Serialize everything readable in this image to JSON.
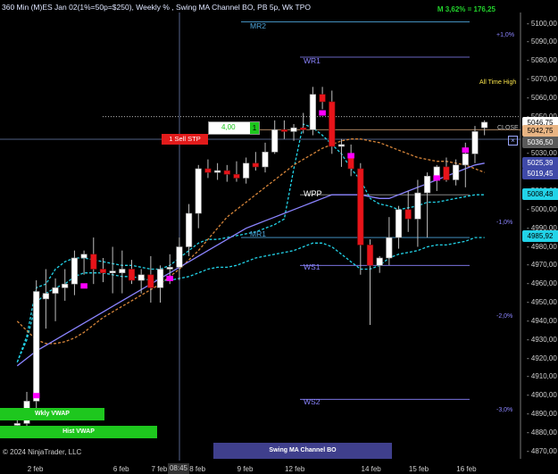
{
  "title": "360 Min (M)ES Jan 02(1%=50p=$250), Weekly % , Swing MA Channel BO, PB 5p, Wk TPO",
  "top_stat": "M 3,62% = 176,25",
  "copyright": "© 2024 NinjaTrader, LLC",
  "time_readout": "08:45",
  "levels": {
    "mr2": "MR2",
    "wr1": "WR1",
    "wpp": "WPP",
    "mr1": "MR1",
    "ws1": "WS1",
    "ws2": "WS2",
    "all_time_high": "All Time High",
    "close": "CLOSE"
  },
  "percent_labels": [
    "+1,0%",
    "-1,0%",
    "-2,0%",
    "-3,0%"
  ],
  "order_widget": {
    "quantity": "4,00",
    "qty_button": "1",
    "sell_stop": "1 Sell STP"
  },
  "buttons": {
    "wkly_vwap": "Wkly VWAP",
    "hist_vwap": "Hist VWAP",
    "swing_ma_channel_bo": "Swing MA Channel BO"
  },
  "price_tags": [
    {
      "label": "5046,75",
      "value": 5046.75,
      "bg": "#ffffff",
      "fg": "#000000"
    },
    {
      "label": "5042,75",
      "value": 5042.75,
      "bg": "#e8b483",
      "fg": "#000000"
    },
    {
      "label": "5036,50",
      "value": 5036.5,
      "bg": "#5a5a5a",
      "fg": "#ffffff"
    },
    {
      "label": "5025,39",
      "value": 5025.39,
      "bg": "#3f4aa8",
      "fg": "#ffffff"
    },
    {
      "label": "5019,45",
      "value": 5019.45,
      "bg": "#3f4aa8",
      "fg": "#ffffff"
    },
    {
      "label": "5008,48",
      "value": 5008.48,
      "bg": "#22d3e8",
      "fg": "#000000"
    },
    {
      "label": "4985,92",
      "value": 4985.92,
      "bg": "#22d3e8",
      "fg": "#000000"
    }
  ],
  "colors": {
    "background": "#000000",
    "bull": "#ffffff",
    "bear": "#e8141a",
    "highlight": "#ff00ff",
    "cyan": "#22d3e8",
    "vwap": "#8b84ff",
    "ma_orange": "#d6853a",
    "level_line": "#8b84ff",
    "mr_level": "#4da3d8"
  },
  "chart_data": {
    "type": "candlestick",
    "title": "360 Min (M)ES Jan 02(1%=50p=$250), Weekly % , Swing MA Channel BO, PB 5p, Wk TPO",
    "y_ticks": [
      5100,
      5090,
      5080,
      5070,
      5060,
      5050,
      5040,
      5030,
      5020,
      5010,
      5000,
      4990,
      4980,
      4970,
      4960,
      4950,
      4940,
      4930,
      4920,
      4910,
      4900,
      4890,
      4880,
      4870
    ],
    "y_tick_labels": [
      "5100,00",
      "5090,00",
      "5080,00",
      "5070,00",
      "5060,00",
      "5050,00",
      "5040,00",
      "5030,00",
      "5020,00",
      "5010,00",
      "5000,00",
      "4990,00",
      "4980,00",
      "4970,00",
      "4960,00",
      "4950,00",
      "4940,00",
      "4930,00",
      "4920,00",
      "4910,00",
      "4900,00",
      "4890,00",
      "4880,00",
      "4870,00"
    ],
    "x_labels": [
      "2 feb",
      "6 feb",
      "7 feb",
      "8 feb",
      "9 feb",
      "12 feb",
      "14 feb",
      "15 feb",
      "16 feb"
    ],
    "x_label_bar_index": [
      2,
      11,
      15,
      19,
      24,
      29,
      37,
      42,
      47
    ],
    "ylim": [
      4866,
      5106
    ],
    "bar_count": 50,
    "candles": [
      {
        "o": 4884,
        "h": 4888,
        "l": 4880,
        "c": 4885
      },
      {
        "o": 4885,
        "h": 4902,
        "l": 4882,
        "c": 4897
      },
      {
        "o": 4897,
        "h": 4962,
        "l": 4893,
        "c": 4956
      },
      {
        "o": 4952,
        "h": 4968,
        "l": 4936,
        "c": 4955
      },
      {
        "o": 4955,
        "h": 4963,
        "l": 4940,
        "c": 4958
      },
      {
        "o": 4958,
        "h": 4968,
        "l": 4951,
        "c": 4960
      },
      {
        "o": 4960,
        "h": 4978,
        "l": 4954,
        "c": 4974
      },
      {
        "o": 4974,
        "h": 4978,
        "l": 4965,
        "c": 4976
      },
      {
        "o": 4976,
        "h": 4985,
        "l": 4960,
        "c": 4968
      },
      {
        "o": 4968,
        "h": 4974,
        "l": 4961,
        "c": 4966
      },
      {
        "o": 4966,
        "h": 4980,
        "l": 4955,
        "c": 4967
      },
      {
        "o": 4966,
        "h": 4978,
        "l": 4955,
        "c": 4968
      },
      {
        "o": 4968,
        "h": 4973,
        "l": 4960,
        "c": 4962
      },
      {
        "o": 4962,
        "h": 4968,
        "l": 4955,
        "c": 4965
      },
      {
        "o": 4965,
        "h": 4975,
        "l": 4950,
        "c": 4958
      },
      {
        "o": 4958,
        "h": 4970,
        "l": 4950,
        "c": 4968
      },
      {
        "o": 4968,
        "h": 4976,
        "l": 4960,
        "c": 4969
      },
      {
        "o": 4969,
        "h": 4985,
        "l": 4962,
        "c": 4980
      },
      {
        "o": 4980,
        "h": 5003,
        "l": 4975,
        "c": 4998
      },
      {
        "o": 4998,
        "h": 5024,
        "l": 4990,
        "c": 5022
      },
      {
        "o": 5022,
        "h": 5027,
        "l": 5017,
        "c": 5020
      },
      {
        "o": 5020,
        "h": 5025,
        "l": 5016,
        "c": 5021
      },
      {
        "o": 5021,
        "h": 5024,
        "l": 5015,
        "c": 5019
      },
      {
        "o": 5019,
        "h": 5026,
        "l": 5015,
        "c": 5017
      },
      {
        "o": 5017,
        "h": 5028,
        "l": 5014,
        "c": 5025
      },
      {
        "o": 5025,
        "h": 5031,
        "l": 5021,
        "c": 5023
      },
      {
        "o": 5023,
        "h": 5036,
        "l": 5020,
        "c": 5031
      },
      {
        "o": 5031,
        "h": 5048,
        "l": 5030,
        "c": 5043
      },
      {
        "o": 5043,
        "h": 5048,
        "l": 5038,
        "c": 5042
      },
      {
        "o": 5042,
        "h": 5046,
        "l": 5037,
        "c": 5044
      },
      {
        "o": 5044,
        "h": 5052,
        "l": 5041,
        "c": 5043
      },
      {
        "o": 5043,
        "h": 5066,
        "l": 5040,
        "c": 5062
      },
      {
        "o": 5062,
        "h": 5066,
        "l": 5054,
        "c": 5058
      },
      {
        "o": 5058,
        "h": 5064,
        "l": 5030,
        "c": 5034
      },
      {
        "o": 5034,
        "h": 5038,
        "l": 5023,
        "c": 5035
      },
      {
        "o": 5030,
        "h": 5035,
        "l": 5018,
        "c": 5022
      },
      {
        "o": 5022,
        "h": 5025,
        "l": 4965,
        "c": 4981
      },
      {
        "o": 4981,
        "h": 4984,
        "l": 4938,
        "c": 4970
      },
      {
        "o": 4970,
        "h": 4975,
        "l": 4966,
        "c": 4974
      },
      {
        "o": 4974,
        "h": 4996,
        "l": 4970,
        "c": 4985
      },
      {
        "o": 4985,
        "h": 5002,
        "l": 4979,
        "c": 5000
      },
      {
        "o": 5000,
        "h": 5010,
        "l": 4988,
        "c": 4995
      },
      {
        "o": 4995,
        "h": 5016,
        "l": 4980,
        "c": 5009
      },
      {
        "o": 5009,
        "h": 5020,
        "l": 4985,
        "c": 5018
      },
      {
        "o": 5018,
        "h": 5024,
        "l": 5010,
        "c": 5023
      },
      {
        "o": 5023,
        "h": 5028,
        "l": 5015,
        "c": 5016
      },
      {
        "o": 5016,
        "h": 5027,
        "l": 5013,
        "c": 5024
      },
      {
        "o": 5024,
        "h": 5036,
        "l": 5012,
        "c": 5030
      },
      {
        "o": 5030,
        "h": 5045,
        "l": 5025,
        "c": 5042
      },
      {
        "o": 5044,
        "h": 5048,
        "l": 5040,
        "c": 5047
      }
    ],
    "series": [
      {
        "type": "line",
        "style": "dashed",
        "color": "#22d3e8",
        "values": [
          4918,
          4930,
          4950,
          4955,
          4958,
          4960,
          4964,
          4966,
          4966,
          4966,
          4965,
          4964,
          4964,
          4963,
          4962,
          4962,
          4962,
          4963,
          4964,
          4966,
          4968,
          4969,
          4969,
          4970,
          4972,
          4974,
          4975,
          4976,
          4977,
          4978,
          4980,
          4982,
          4982,
          4980,
          4976,
          4972,
          4968,
          4968,
          4970,
          4974,
          4976,
          4977,
          4978,
          4980,
          4981,
          4981,
          4982,
          4983,
          4985,
          4985
        ]
      },
      {
        "type": "line",
        "style": "dashed",
        "color": "#22d3e8",
        "values": [
          4918,
          4932,
          4958,
          4960,
          4968,
          4972,
          4974,
          4974,
          4973,
          4972,
          4971,
          4970,
          4970,
          4969,
          4968,
          4968,
          4970,
          4974,
          4978,
          4982,
          4984,
          4984,
          4985,
          4986,
          4987,
          4988,
          4990,
          4992,
          4995,
          5022,
          5046,
          5044,
          5040,
          5035,
          5030,
          5022,
          5016,
          5006,
          5003,
          5002,
          5000,
          5001,
          5002,
          5004,
          5004,
          5005,
          5006,
          5007,
          5008,
          5008
        ]
      },
      {
        "type": "line",
        "style": "dashed",
        "color": "#d6853a",
        "values": [
          4940,
          4935,
          4930,
          4928,
          4928,
          4929,
          4931,
          4934,
          4938,
          4942,
          4945,
          4948,
          4951,
          4954,
          4957,
          4960,
          4964,
          4968,
          4973,
          4978,
          4984,
          4990,
          4996,
          5000,
          5004,
          5008,
          5012,
          5016,
          5020,
          5024,
          5027,
          5030,
          5033,
          5035,
          5037,
          5038,
          5038,
          5037,
          5036,
          5034,
          5032,
          5030,
          5028,
          5027,
          5026,
          5026,
          5025,
          5024,
          5022,
          5020
        ]
      },
      {
        "type": "line",
        "style": "solid",
        "color": "#8b84ff",
        "values": [
          4916,
          4920,
          4924,
          4927,
          4930,
          4933,
          4936,
          4939,
          4942,
          4945,
          4948,
          4951,
          4954,
          4957,
          4960,
          4963,
          4966,
          4969,
          4972,
          4975,
          4978,
          4981,
          4984,
          4987,
          4990,
          4992,
          4994,
          4996,
          4998,
          5000,
          5002,
          5004,
          5006,
          5008,
          5008,
          5008,
          5008,
          5007,
          5006,
          5006,
          5008,
          5010,
          5012,
          5014,
          5016,
          5018,
          5020,
          5022,
          5024,
          5025
        ]
      }
    ],
    "highlight_bars": [
      {
        "index": 2,
        "value": 4900
      },
      {
        "index": 7,
        "value": 4959
      },
      {
        "index": 16,
        "value": 4963
      },
      {
        "index": 32,
        "value": 5052
      },
      {
        "index": 35,
        "value": 5029
      },
      {
        "index": 44,
        "value": 5017
      },
      {
        "index": 47,
        "value": 5032
      }
    ],
    "horizontal_levels": [
      {
        "name": "MR2",
        "value": 5101
      },
      {
        "name": "WR1",
        "value": 5082
      },
      {
        "name": "ATH",
        "value": 5050
      },
      {
        "name": "CLOSE",
        "value": 5043
      },
      {
        "name": "WPP",
        "value": 5008
      },
      {
        "name": "MR1",
        "value": 4985
      },
      {
        "name": "WS1",
        "value": 4970
      },
      {
        "name": "WS2",
        "value": 4898
      }
    ],
    "grid": false
  }
}
